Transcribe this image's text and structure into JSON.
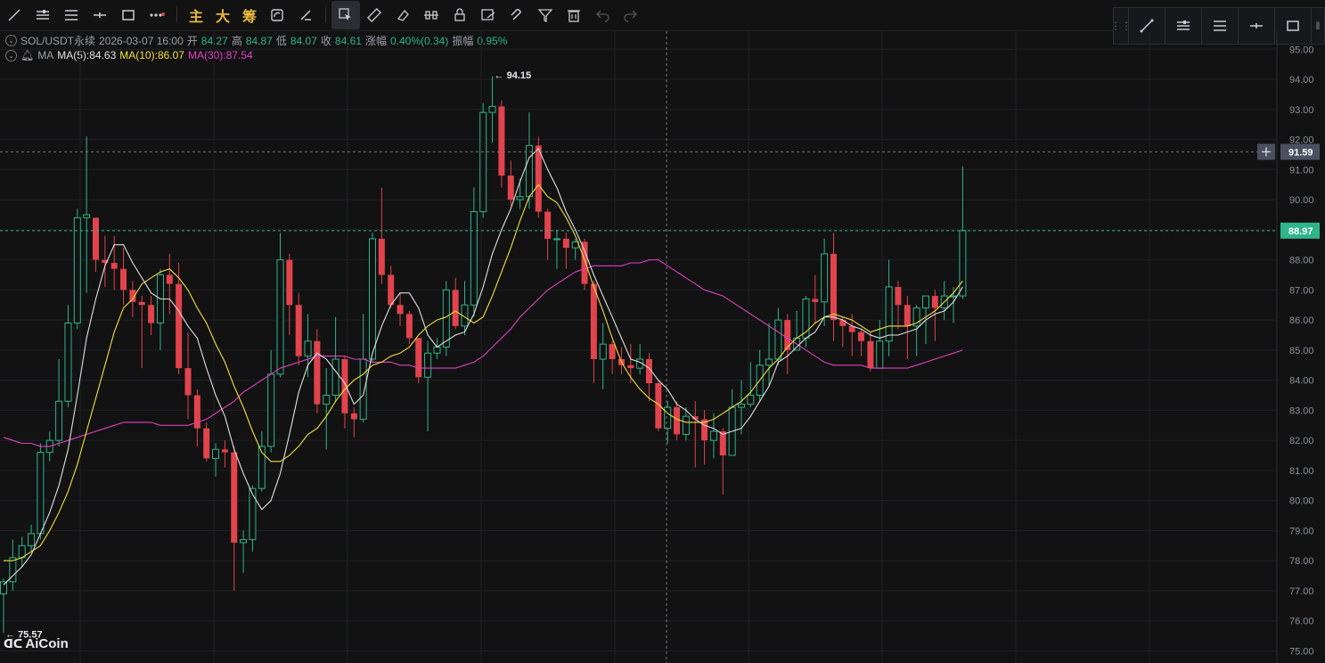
{
  "header": {
    "symbol": "SOL/USDT永续",
    "datetime": "2026-03-07 16:00",
    "open_label": "开",
    "open": "84.27",
    "high_label": "高",
    "high": "84.87",
    "low_label": "低",
    "low": "84.07",
    "close_label": "收",
    "close": "84.61",
    "change_label": "涨幅",
    "change": "0.40%(0.34)",
    "amp_label": "振幅",
    "amp": "0.95%"
  },
  "ma": {
    "label": "MA",
    "ma5": "MA(5):84.63",
    "ma10": "MA(10):86.07",
    "ma30": "MA(30):87.54",
    "colors": {
      "ma5": "#e0e0e0",
      "ma10": "#f2e13c",
      "ma30": "#e040c0"
    }
  },
  "toolbar": {
    "main_label": "主",
    "big_label": "大",
    "chip_label": "筹"
  },
  "price_tags": {
    "crosshair": "91.59",
    "last": "88.97"
  },
  "annotations": {
    "high": "94.15",
    "low": "75.57"
  },
  "logo": {
    "text": "AiCoin"
  },
  "colors": {
    "up": "#2fb58a",
    "down": "#e2434d",
    "bg": "#121212",
    "grid": "#1e2024"
  },
  "chart_data": {
    "type": "candlestick",
    "y_ticks": [
      "95.00",
      "94.00",
      "93.00",
      "92.00",
      "91.00",
      "90.00",
      "89.00",
      "88.00",
      "87.00",
      "86.00",
      "85.00",
      "84.00",
      "83.00",
      "82.00",
      "81.00",
      "80.00",
      "79.00",
      "78.00",
      "77.00",
      "76.00",
      "75.00"
    ],
    "ylim": [
      74.6,
      95.6
    ],
    "ohlc": [
      [
        76.9,
        77.3,
        75.6,
        77.4
      ],
      [
        77.3,
        78.1,
        77.0,
        78.7
      ],
      [
        78.1,
        78.5,
        77.8,
        78.8
      ],
      [
        78.5,
        78.9,
        78.3,
        79.2
      ],
      [
        78.9,
        81.6,
        78.7,
        81.9
      ],
      [
        81.6,
        82.0,
        81.3,
        82.3
      ],
      [
        82.0,
        83.3,
        81.8,
        84.7
      ],
      [
        83.3,
        85.9,
        83.1,
        86.5
      ],
      [
        85.9,
        89.4,
        85.7,
        89.7
      ],
      [
        89.4,
        89.5,
        86.9,
        92.1
      ],
      [
        89.4,
        88.0,
        87.6,
        89.3
      ],
      [
        88.0,
        87.9,
        87.1,
        88.8
      ],
      [
        87.9,
        87.7,
        87.0,
        88.8
      ],
      [
        87.7,
        87.0,
        86.5,
        88.4
      ],
      [
        87.0,
        86.6,
        86.1,
        87.3
      ],
      [
        86.6,
        86.5,
        84.4,
        86.8
      ],
      [
        86.5,
        85.9,
        85.5,
        86.8
      ],
      [
        85.9,
        87.5,
        85.0,
        87.7
      ],
      [
        87.5,
        87.2,
        86.2,
        88.2
      ],
      [
        87.2,
        84.4,
        84.2,
        87.9
      ],
      [
        84.4,
        83.5,
        82.7,
        85.6
      ],
      [
        83.5,
        82.4,
        81.8,
        83.7
      ],
      [
        82.4,
        81.4,
        81.3,
        82.6
      ],
      [
        81.4,
        81.7,
        80.8,
        81.9
      ],
      [
        81.7,
        81.6,
        81.1,
        82.0
      ],
      [
        81.6,
        78.6,
        77.0,
        81.8
      ],
      [
        78.6,
        78.7,
        77.6,
        79.0
      ],
      [
        78.7,
        80.4,
        78.3,
        80.5
      ],
      [
        80.4,
        81.8,
        80.3,
        82.3
      ],
      [
        81.8,
        84.2,
        81.6,
        85.0
      ],
      [
        84.2,
        88.0,
        84.1,
        88.9
      ],
      [
        88.0,
        86.5,
        85.5,
        88.2
      ],
      [
        86.5,
        84.8,
        84.5,
        86.9
      ],
      [
        84.8,
        85.3,
        84.1,
        86.2
      ],
      [
        85.3,
        83.2,
        82.9,
        85.7
      ],
      [
        83.2,
        83.5,
        81.7,
        84.4
      ],
      [
        83.5,
        84.7,
        83.3,
        86.1
      ],
      [
        84.7,
        82.9,
        82.4,
        84.8
      ],
      [
        82.9,
        82.7,
        82.1,
        83.1
      ],
      [
        82.7,
        84.7,
        82.6,
        86.2
      ],
      [
        84.7,
        88.7,
        84.6,
        88.9
      ],
      [
        88.7,
        87.5,
        87.2,
        90.4
      ],
      [
        87.5,
        86.5,
        86.4,
        87.8
      ],
      [
        86.5,
        86.2,
        85.8,
        86.9
      ],
      [
        86.2,
        85.4,
        85.2,
        86.3
      ],
      [
        85.4,
        84.1,
        83.9,
        85.4
      ],
      [
        84.1,
        84.9,
        82.3,
        85.3
      ],
      [
        84.9,
        85.1,
        84.7,
        85.4
      ],
      [
        85.1,
        87.0,
        84.8,
        87.3
      ],
      [
        87.0,
        85.8,
        85.7,
        87.4
      ],
      [
        85.8,
        86.5,
        85.5,
        87.3
      ],
      [
        86.5,
        89.6,
        86.1,
        90.4
      ],
      [
        89.6,
        92.9,
        89.4,
        93.2
      ],
      [
        92.9,
        93.1,
        91.9,
        94.1
      ],
      [
        93.1,
        90.8,
        90.4,
        93.3
      ],
      [
        90.8,
        90.0,
        89.8,
        91.3
      ],
      [
        90.0,
        90.1,
        89.7,
        90.7
      ],
      [
        90.1,
        91.8,
        89.7,
        92.9
      ],
      [
        91.8,
        89.6,
        89.4,
        92.1
      ],
      [
        89.6,
        88.7,
        88.0,
        89.7
      ],
      [
        88.7,
        88.7,
        87.7,
        89.0
      ],
      [
        88.7,
        88.4,
        87.7,
        88.9
      ],
      [
        88.4,
        88.6,
        88.0,
        88.7
      ],
      [
        88.6,
        87.2,
        87.0,
        88.7
      ],
      [
        87.2,
        84.7,
        83.9,
        87.3
      ],
      [
        84.7,
        85.2,
        83.7,
        85.9
      ],
      [
        85.2,
        84.7,
        84.2,
        85.3
      ],
      [
        84.7,
        84.5,
        84.2,
        85.1
      ],
      [
        84.5,
        84.4,
        83.9,
        85.2
      ],
      [
        84.4,
        84.7,
        84.2,
        85.2
      ],
      [
        84.7,
        83.9,
        83.3,
        84.9
      ],
      [
        83.9,
        82.4,
        82.3,
        84.0
      ],
      [
        82.4,
        83.1,
        81.9,
        83.3
      ],
      [
        83.1,
        82.2,
        82.0,
        83.3
      ],
      [
        82.2,
        82.8,
        82.0,
        83.1
      ],
      [
        82.8,
        82.7,
        81.1,
        83.3
      ],
      [
        82.7,
        82.0,
        81.2,
        83.0
      ],
      [
        82.0,
        82.3,
        81.4,
        82.9
      ],
      [
        82.3,
        81.5,
        80.2,
        82.4
      ],
      [
        81.5,
        83.1,
        81.5,
        83.7
      ],
      [
        83.1,
        83.2,
        82.2,
        84.0
      ],
      [
        83.2,
        83.5,
        83.1,
        84.6
      ],
      [
        83.5,
        84.5,
        83.3,
        85.0
      ],
      [
        84.5,
        84.7,
        83.8,
        85.9
      ],
      [
        84.7,
        86.0,
        84.5,
        86.4
      ],
      [
        86.0,
        85.0,
        84.2,
        86.2
      ],
      [
        85.0,
        85.4,
        85.0,
        86.3
      ],
      [
        85.4,
        86.7,
        85.1,
        86.8
      ],
      [
        86.7,
        86.6,
        85.9,
        87.5
      ],
      [
        86.6,
        88.2,
        85.8,
        88.7
      ],
      [
        88.2,
        86.0,
        85.3,
        88.9
      ],
      [
        86.0,
        85.8,
        85.1,
        86.1
      ],
      [
        85.8,
        85.6,
        84.8,
        86.2
      ],
      [
        85.6,
        85.3,
        84.8,
        85.7
      ],
      [
        85.3,
        84.4,
        84.3,
        85.6
      ],
      [
        84.4,
        85.3,
        84.4,
        86.0
      ],
      [
        85.3,
        87.1,
        84.8,
        88.0
      ],
      [
        87.1,
        86.5,
        85.7,
        87.3
      ],
      [
        86.5,
        85.8,
        84.7,
        86.8
      ],
      [
        85.8,
        86.4,
        84.8,
        86.5
      ],
      [
        86.4,
        86.8,
        85.2,
        86.8
      ],
      [
        86.8,
        86.4,
        85.3,
        87.0
      ],
      [
        86.4,
        86.8,
        86.0,
        87.3
      ],
      [
        86.8,
        86.8,
        85.9,
        87.1
      ],
      [
        86.8,
        88.97,
        86.7,
        91.1
      ]
    ],
    "ma5": [
      77.2,
      77.5,
      77.8,
      78.2,
      78.9,
      79.6,
      80.5,
      81.7,
      83.5,
      85.4,
      86.7,
      87.8,
      88.5,
      88.5,
      87.9,
      87.4,
      86.9,
      86.7,
      86.7,
      86.3,
      85.8,
      85.4,
      84.4,
      83.5,
      82.8,
      81.7,
      80.9,
      80.2,
      79.7,
      80.0,
      80.9,
      82.2,
      83.6,
      84.5,
      84.9,
      84.7,
      84.3,
      83.9,
      83.2,
      83.5,
      84.9,
      85.8,
      86.5,
      86.9,
      86.9,
      86.4,
      85.5,
      85.1,
      85.3,
      85.5,
      85.6,
      86.2,
      87.1,
      88.2,
      89.0,
      89.7,
      90.6,
      91.4,
      91.7,
      91.0,
      90.4,
      89.6,
      89.0,
      88.3,
      87.5,
      86.8,
      86.1,
      85.4,
      84.7,
      84.6,
      84.4,
      84.0,
      83.7,
      83.2,
      83.0,
      82.7,
      82.5,
      82.4,
      82.2,
      82.3,
      82.4,
      82.8,
      83.3,
      83.8,
      84.6,
      84.8,
      85.1,
      85.4,
      85.6,
      86.1,
      86.1,
      86.0,
      85.8,
      85.7,
      85.5,
      85.4,
      85.5,
      85.5,
      85.6,
      85.7,
      86.0,
      86.2,
      86.3,
      86.6,
      87.1
    ],
    "ma10": [
      78.0,
      78.0,
      78.1,
      78.3,
      78.5,
      79.0,
      79.6,
      80.3,
      81.2,
      82.3,
      83.4,
      84.5,
      85.6,
      86.4,
      86.7,
      87.2,
      87.4,
      87.6,
      87.7,
      87.4,
      87.0,
      86.4,
      85.9,
      85.2,
      84.6,
      83.8,
      83.1,
      82.3,
      81.6,
      81.3,
      81.3,
      81.5,
      81.8,
      82.2,
      82.4,
      82.8,
      83.3,
      83.7,
      84.0,
      84.2,
      84.5,
      84.6,
      84.8,
      84.9,
      85.1,
      85.5,
      85.8,
      86.0,
      86.1,
      86.3,
      86.1,
      85.9,
      86.1,
      86.8,
      87.6,
      88.4,
      89.3,
      90.1,
      90.5,
      90.1,
      89.9,
      89.4,
      88.8,
      88.0,
      87.1,
      86.3,
      85.4,
      84.6,
      84.1,
      83.7,
      83.4,
      83.2,
      82.9,
      82.7,
      82.6,
      82.6,
      82.6,
      82.7,
      82.9,
      83.1,
      83.3,
      83.6,
      84.0,
      84.4,
      84.7,
      85.1,
      85.4,
      85.6,
      85.9,
      86.1,
      86.2,
      86.1,
      86.0,
      85.8,
      85.6,
      85.7,
      85.8,
      85.8,
      85.8,
      85.9,
      86.1,
      86.3,
      86.6,
      86.9,
      87.3
    ],
    "ma30": [
      82.1,
      82.0,
      81.9,
      81.9,
      81.8,
      81.8,
      81.9,
      82.0,
      82.1,
      82.2,
      82.3,
      82.4,
      82.5,
      82.6,
      82.6,
      82.6,
      82.6,
      82.5,
      82.5,
      82.5,
      82.5,
      82.6,
      82.7,
      82.9,
      83.1,
      83.3,
      83.6,
      83.8,
      84.0,
      84.2,
      84.4,
      84.5,
      84.6,
      84.7,
      84.8,
      84.8,
      84.8,
      84.8,
      84.7,
      84.7,
      84.6,
      84.6,
      84.6,
      84.5,
      84.5,
      84.4,
      84.4,
      84.4,
      84.4,
      84.4,
      84.5,
      84.6,
      84.8,
      85.1,
      85.4,
      85.7,
      86.1,
      86.4,
      86.7,
      87.0,
      87.2,
      87.4,
      87.6,
      87.7,
      87.8,
      87.8,
      87.8,
      87.8,
      87.9,
      87.9,
      88.0,
      88.0,
      87.8,
      87.6,
      87.4,
      87.2,
      87.0,
      86.9,
      86.8,
      86.6,
      86.4,
      86.2,
      86.0,
      85.8,
      85.6,
      85.4,
      85.2,
      85.0,
      84.8,
      84.6,
      84.5,
      84.5,
      84.5,
      84.5,
      84.4,
      84.4,
      84.4,
      84.4,
      84.4,
      84.5,
      84.6,
      84.7,
      84.8,
      84.9,
      85.0
    ]
  }
}
